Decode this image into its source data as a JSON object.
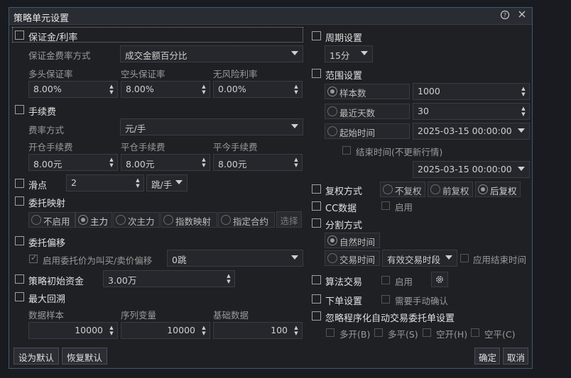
{
  "window": {
    "title": "策略单元设置",
    "help_icon": "help-icon",
    "close_icon": "close-icon"
  },
  "margin": {
    "title": "保证金/利率",
    "method_label": "保证金费率方式",
    "method_value": "成交金额百分比",
    "long_label": "多头保证率",
    "long_value": "8.00%",
    "short_label": "空头保证率",
    "short_value": "8.00%",
    "riskfree_label": "无风险利率",
    "riskfree_value": "0.00%"
  },
  "fee": {
    "title": "手续费",
    "method_label": "费率方式",
    "method_value": "元/手",
    "open_label": "开仓手续费",
    "open_value": "8.00元",
    "close_label": "平仓手续费",
    "close_value": "8.00元",
    "closetoday_label": "平今手续费",
    "closetoday_value": "8.00元"
  },
  "slippage": {
    "title": "滑点",
    "value": "2",
    "unit": "跳/手"
  },
  "order_map": {
    "title": "委托映射",
    "options": [
      "不启用",
      "主力",
      "次主力",
      "指数映射",
      "指定合约"
    ],
    "selected_index": 1,
    "select_label": "选择"
  },
  "order_offset": {
    "title": "委托偏移",
    "enable_label": "启用委托价为叫买/卖价偏移",
    "value": "0跳"
  },
  "initial_capital": {
    "title": "策略初始资金",
    "value": "3.00万"
  },
  "max_drawdown": {
    "title": "最大回溯",
    "sample_label": "数据样本",
    "sample_value": "10000",
    "series_label": "序列变量",
    "series_value": "10000",
    "base_label": "基础数据",
    "base_value": "100"
  },
  "period": {
    "title": "周期设置",
    "value": "15分"
  },
  "range": {
    "title": "范围设置",
    "samples_label": "样本数",
    "samples_value": "1000",
    "days_label": "最近天数",
    "days_value": "30",
    "start_label": "起始时间",
    "start_value": "2025-03-15 00:00:00",
    "end_label": "结束时间(不更新行情)",
    "end_value": "2025-03-15 00:00:00"
  },
  "adjust": {
    "title": "复权方式",
    "options": [
      "不复权",
      "前复权",
      "后复权"
    ],
    "selected_index": 2
  },
  "cc": {
    "title": "CC数据",
    "enable_label": "启用"
  },
  "split": {
    "title": "分割方式",
    "natural_label": "自然时间",
    "trade_label": "交易时间",
    "trade_value": "有效交易时段",
    "apply_end_label": "应用结束时间"
  },
  "algo": {
    "title": "算法交易",
    "enable_label": "启用",
    "gear_icon": "gear-icon"
  },
  "order_setting": {
    "title": "下单设置",
    "manual_label": "需要手动确认"
  },
  "ignore": {
    "title": "忽略程序化自动交易委托单设置",
    "options": [
      "多开(B)",
      "多平(S)",
      "空开(H)",
      "空平(C)"
    ]
  },
  "footer": {
    "set_default": "设为默认",
    "restore_default": "恢复默认",
    "ok": "确定",
    "cancel": "取消"
  }
}
